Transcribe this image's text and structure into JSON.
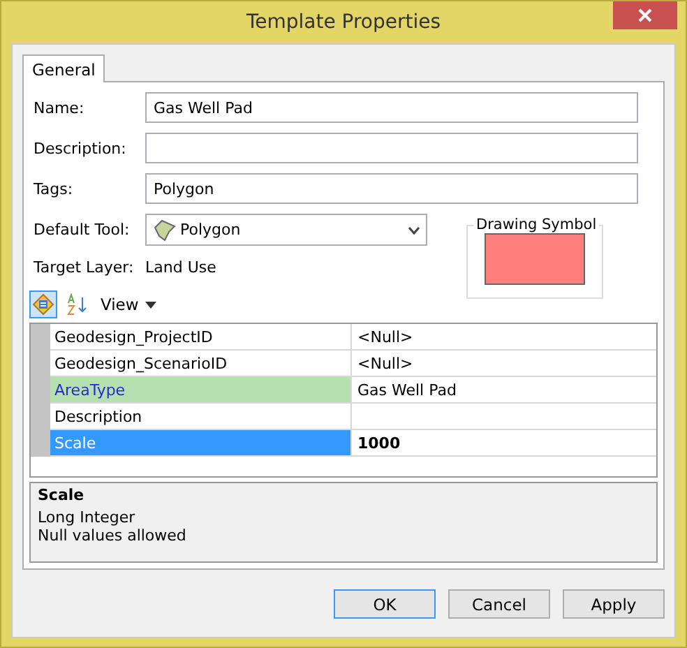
{
  "window": {
    "title": "Template Properties"
  },
  "tabs": [
    {
      "label": "General",
      "selected": true
    }
  ],
  "form": {
    "name": {
      "label": "Name:",
      "value": "Gas Well Pad"
    },
    "description": {
      "label": "Description:"
    },
    "tags": {
      "label": "Tags:",
      "value": "Polygon"
    },
    "default_tool": {
      "label": "Default Tool:",
      "value": "Polygon"
    },
    "target_layer": {
      "label": "Target Layer:",
      "value": "Land Use"
    },
    "drawing_symbol": {
      "label": "Drawing Symbol",
      "color": "#ff7f7f"
    }
  },
  "toolbar": {
    "categorized_selected": true,
    "alphabetical_selected": false,
    "view_label": "View"
  },
  "properties": [
    {
      "name": "Geodesign_ProjectID",
      "value": "<Null>",
      "selected": false,
      "highlighted": false
    },
    {
      "name": "Geodesign_ScenarioID",
      "value": "<Null>",
      "selected": false,
      "highlighted": false
    },
    {
      "name": "AreaType",
      "value": "Gas Well Pad",
      "selected": false,
      "highlighted": true
    },
    {
      "name": "Description",
      "selected": false,
      "highlighted": false
    },
    {
      "name": "Scale",
      "value": "1000",
      "selected": true,
      "highlighted": false
    }
  ],
  "info": {
    "title": "Scale",
    "lines": [
      "Long Integer",
      "Null values allowed"
    ]
  },
  "buttons": [
    {
      "label": "OK",
      "default": true
    },
    {
      "label": "Cancel",
      "default": false
    },
    {
      "label": "Apply",
      "default": false
    }
  ]
}
